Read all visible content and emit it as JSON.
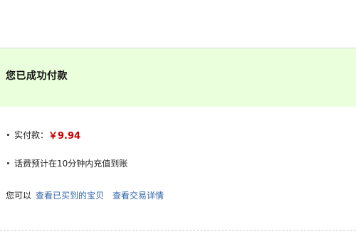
{
  "banner": {
    "title": "您已成功付款"
  },
  "payment": {
    "label": "实付款：",
    "amount": "￥9.94"
  },
  "note": {
    "text": "话费预计在10分钟内充值到账"
  },
  "actions": {
    "prefix": "您可以",
    "view_purchased_link": "查看已买到的宝贝",
    "view_details_link": "查看交易详情"
  },
  "colors": {
    "banner_bg": "#eaffdc",
    "amount": "#cc0000",
    "link": "#3366aa"
  }
}
